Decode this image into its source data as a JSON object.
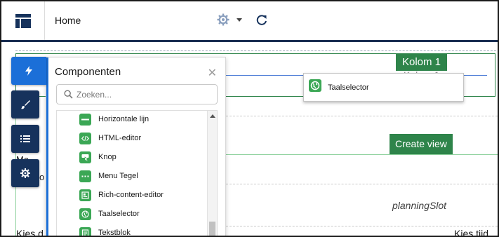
{
  "header": {
    "page_name": "Home",
    "icons": [
      "app-launcher-icon",
      "gear-icon",
      "chevron-down-icon",
      "refresh-icon"
    ]
  },
  "canvas": {
    "column_tag": "Kolom 1",
    "column_ghost": "Kolom 1",
    "create_view_label": "Create view",
    "planning_slot": "planningSlot",
    "kies_tijd": "Kies tijd",
    "kies_left": "Kies d",
    "fragment_ma": "Ma",
    "fragment_o": "o"
  },
  "drag_ghost": {
    "label": "Taalselector",
    "icon": "globe-icon"
  },
  "side_tabs": [
    {
      "name": "components",
      "icon": "lightning-icon",
      "active": true
    },
    {
      "name": "theme",
      "icon": "brush-icon",
      "active": false
    },
    {
      "name": "page-structure",
      "icon": "list-icon",
      "active": false
    },
    {
      "name": "settings",
      "icon": "gear-icon",
      "active": false
    }
  ],
  "panel": {
    "title": "Componenten",
    "close_icon": "close-icon",
    "search_placeholder": "Zoeken...",
    "search_value": "",
    "items": [
      {
        "label": "Horizontale lijn",
        "icon": "divider-icon"
      },
      {
        "label": "HTML-editor",
        "icon": "code-icon"
      },
      {
        "label": "Knop",
        "icon": "button-icon"
      },
      {
        "label": "Menu Tegel",
        "icon": "menu-tile-icon"
      },
      {
        "label": "Rich-content-editor",
        "icon": "rich-content-icon"
      },
      {
        "label": "Taalselector",
        "icon": "globe-icon"
      },
      {
        "label": "Tekstblok",
        "icon": "text-block-icon"
      }
    ]
  },
  "colors": {
    "header_underline": "#1a2e52",
    "tab_navy": "#16325c",
    "tab_active": "#1b6fd8",
    "green": "#2e844a",
    "component_icon_green": "#3ba755"
  }
}
